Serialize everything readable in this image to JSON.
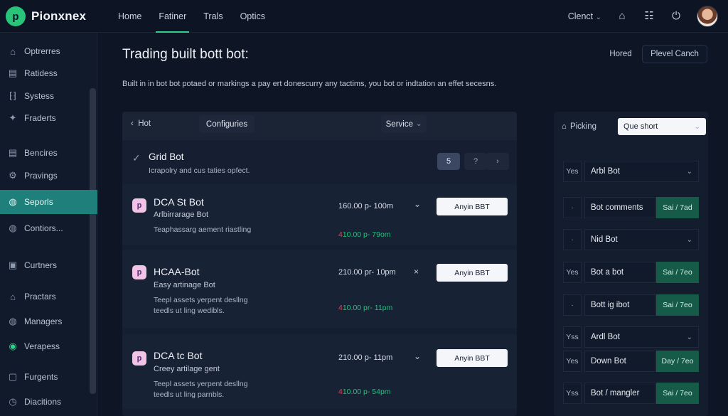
{
  "brand": {
    "name": "Pionxnex",
    "logo_letter": "p"
  },
  "nav": [
    "Home",
    "Fatiner",
    "Trals",
    "Optics"
  ],
  "topbar": {
    "client": "Clenct"
  },
  "sidebar": [
    "Optrerres",
    "Ratidess",
    "Systess",
    "Fraderts",
    "Bencires",
    "Pravings",
    "Seporls",
    "Contiors...",
    "Curtners",
    "Practars",
    "Managers",
    "Verapess",
    "Furgents",
    "Diacitions"
  ],
  "page": {
    "title": "Trading built bott bot:",
    "description": "Built in in bot bot potaed or markings a pay ert donescurry any tactims, you bot or indtation an effet secesns.",
    "btn_hored": "Hored",
    "btn_plevel": "Plevel Canch"
  },
  "panel": {
    "hot": "Hot",
    "configuries": "Configuries",
    "service": "Service",
    "grid": {
      "title": "Grid Bot",
      "subtitle": "Icrapolry and cus taties opfect."
    },
    "pagination": [
      "5",
      "?",
      "›"
    ]
  },
  "bots": [
    {
      "icon": "p",
      "name": "DCA St Bot",
      "sub": "Arlbirrarage Bot",
      "desc": "Teaphassarg aement riastling",
      "price": "160.00 p- 100m",
      "change_neg": "4",
      "change": "10.00 p- 79om",
      "toggle": "⌄",
      "button": "Anyin BBT"
    },
    {
      "icon": "p",
      "name": "HCAA-Bot",
      "sub": "Easy artinage Bot",
      "desc": "Teepl assets yerpent desllng\nteedls ut ling wedibls.",
      "price": "210.00 pr- 10pm",
      "change_neg": "4",
      "change": "10.00 pr- 11pm",
      "toggle": "×",
      "button": "Anyin BBT"
    },
    {
      "icon": "p",
      "name": "DCA tc Bot",
      "sub": "Creey artilage gent",
      "desc": "Teepl assets yerpent desllng\nteedls ut ling parnbls.",
      "price": "210.00 p- 11pm",
      "change_neg": "4",
      "change": "10.00 p- 54pm",
      "toggle": "⌄",
      "button": "Anyin BBT"
    }
  ],
  "right": {
    "picking": "Picking",
    "select": "Que short",
    "rows": [
      {
        "label": "Yes",
        "field": "Arbl Bot",
        "chev": true,
        "green": ""
      },
      {
        "label": "·",
        "field": "Bot comments",
        "chev": false,
        "green": "Sai / 7ad"
      },
      {
        "label": "·",
        "field": "Nid Bot",
        "chev": true,
        "green": ""
      },
      {
        "label": "Yes",
        "field": "Bot a bot",
        "chev": false,
        "green": "Sai / 7eo"
      },
      {
        "label": "·",
        "field": "Bott ig ibot",
        "chev": false,
        "green": "Sai / 7eo"
      },
      {
        "label": "Yss",
        "field": "Ardl Bot",
        "chev": true,
        "green": ""
      },
      {
        "label": "Yes",
        "field": "Down Bot",
        "chev": false,
        "green": "Day / 7eo"
      },
      {
        "label": "Yss",
        "field": "Bot / mangler",
        "chev": false,
        "green": "Sai / 7eo"
      }
    ]
  },
  "colors": {
    "accent": "#2fd08a",
    "sidebar_active": "#1f7f7a",
    "green_cell": "#165a48",
    "negative": "#e0434b"
  }
}
